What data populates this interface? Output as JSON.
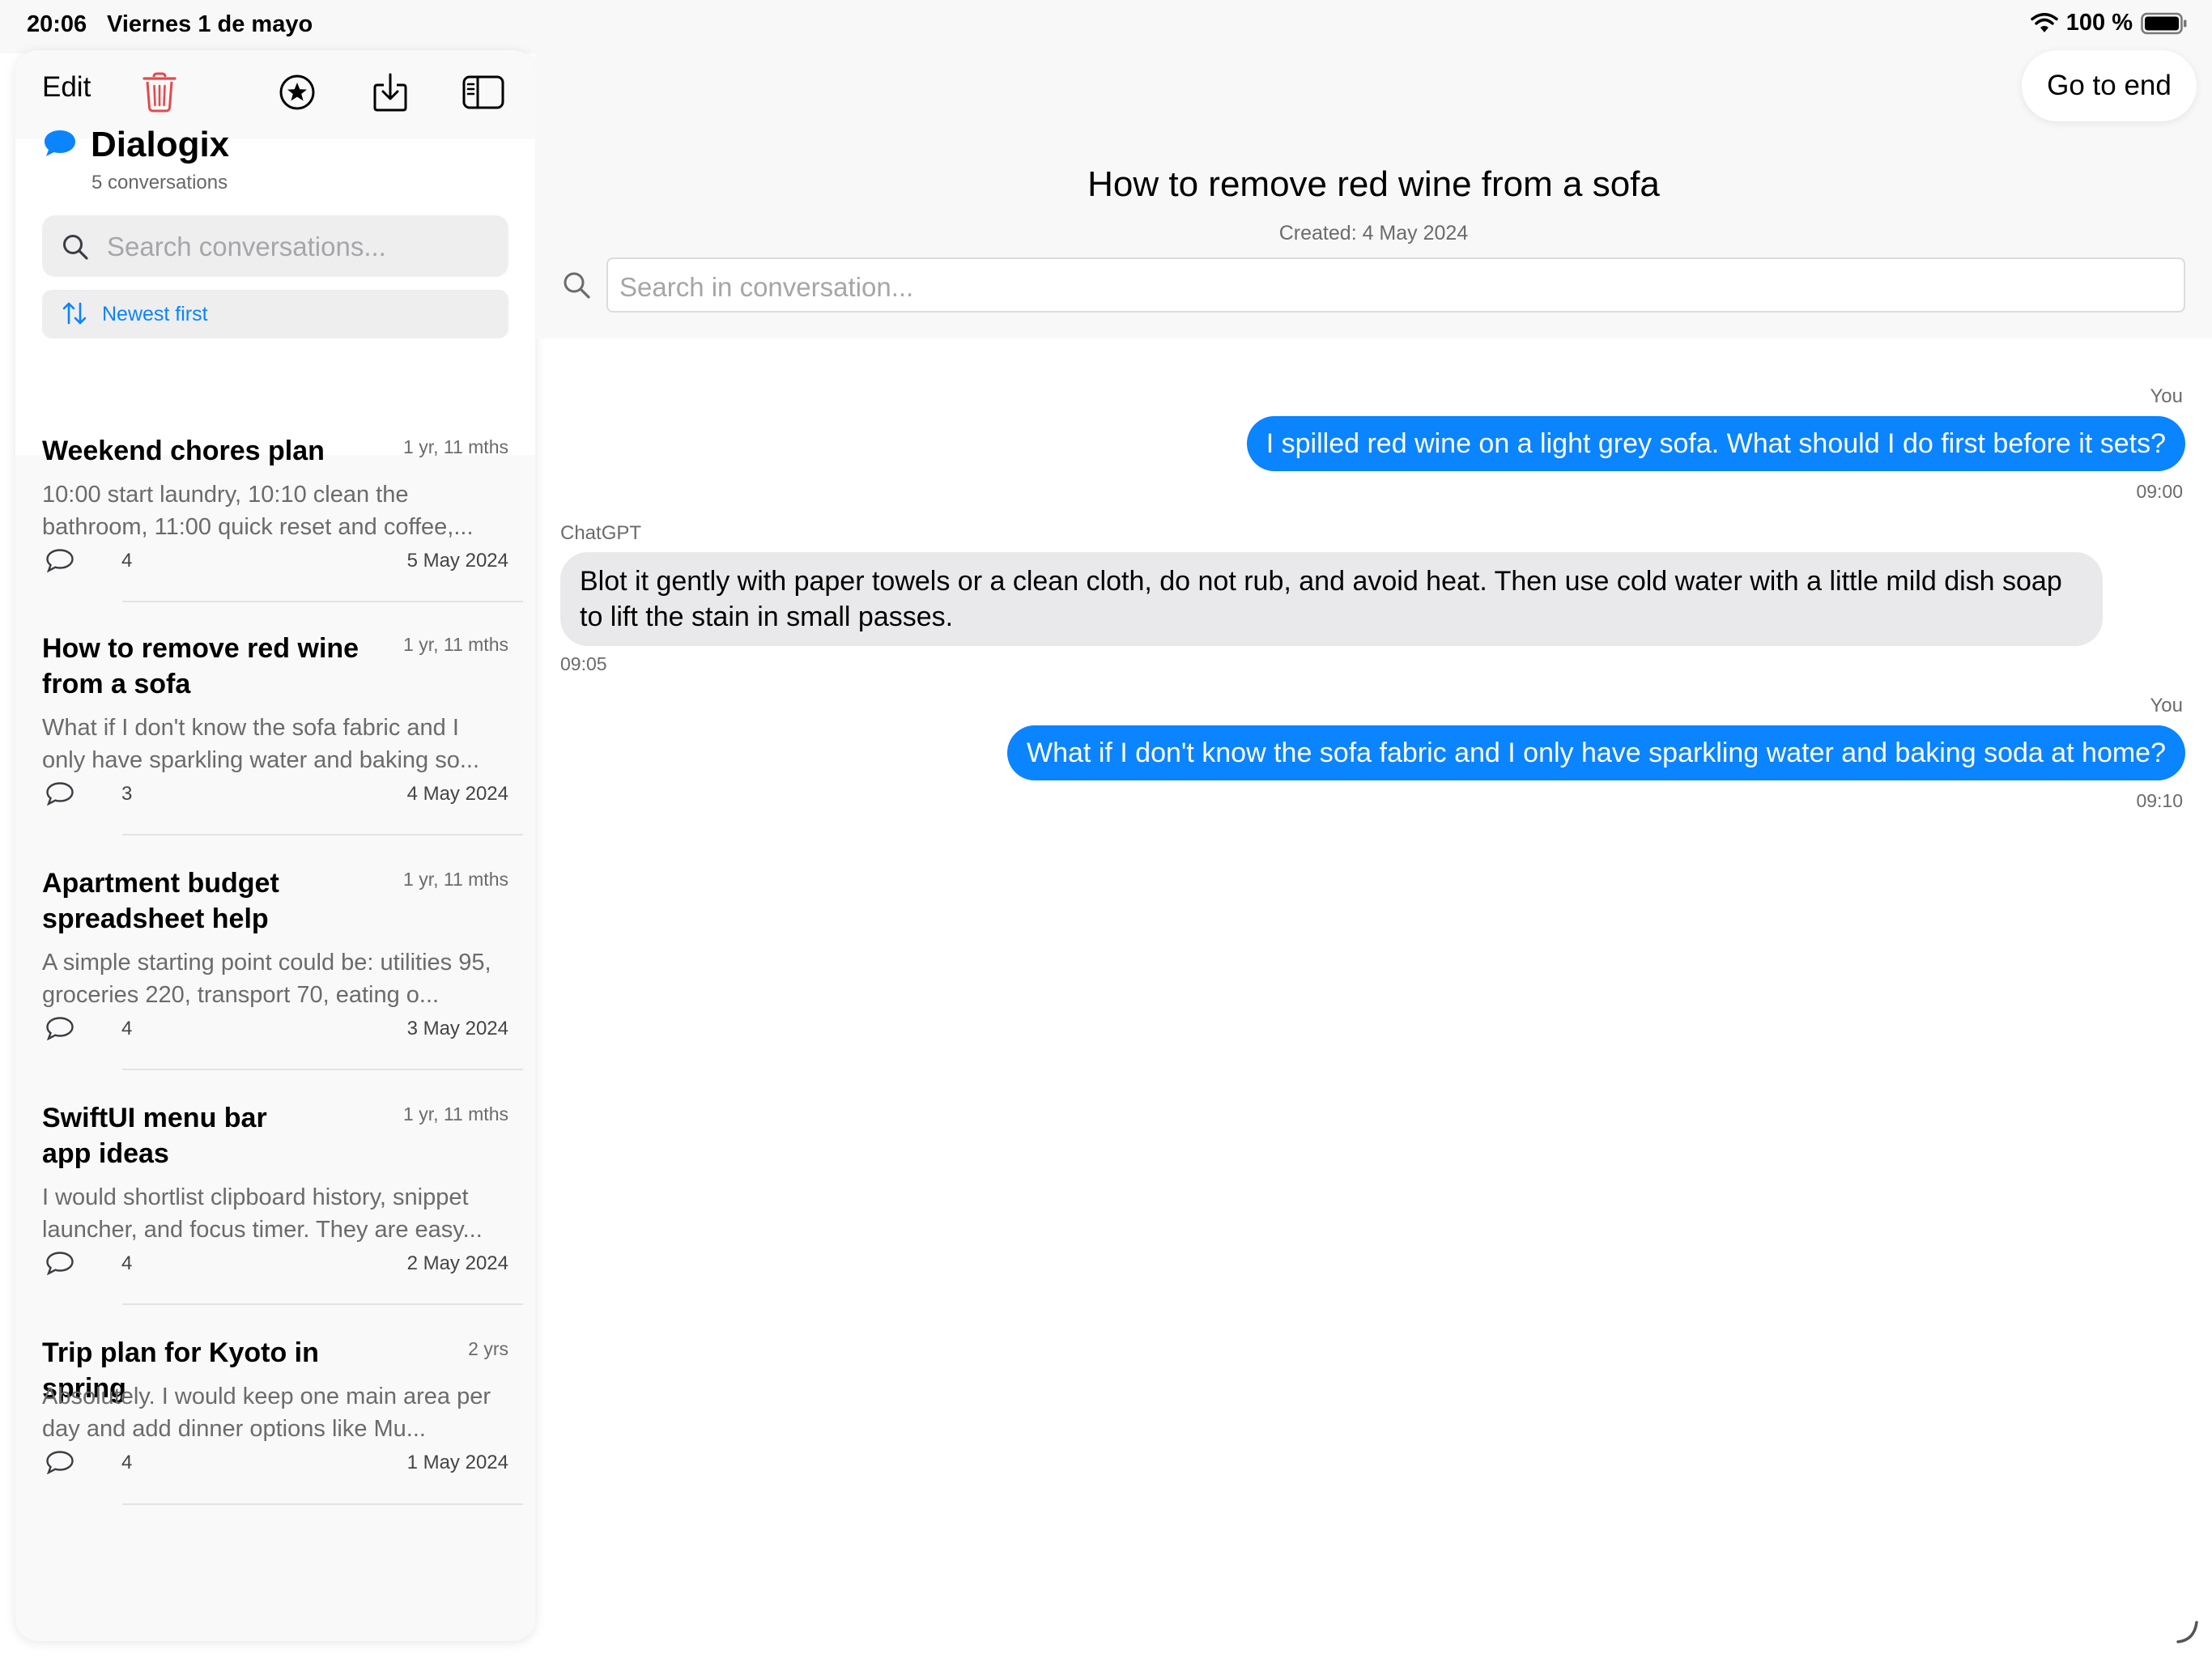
{
  "status_bar": {
    "time": "20:06",
    "date": "Viernes 1 de mayo",
    "battery": "100 %"
  },
  "sidebar": {
    "edit_label": "Edit",
    "app_title": "Dialogix",
    "conversation_count": "5 conversations",
    "search_placeholder": "Search conversations...",
    "sort_label": "Newest first",
    "conversations": [
      {
        "title": "Weekend chores plan",
        "age": "1 yr, 11 mths",
        "preview": "10:00 start laundry, 10:10 clean the bathroom, 11:00 quick reset and coffee,...",
        "messages": "4",
        "date": "5 May 2024"
      },
      {
        "title": "How to remove red wine from a sofa",
        "age": "1 yr, 11 mths",
        "preview": "What if I don't know the sofa fabric and I only have sparkling water and baking so...",
        "messages": "3",
        "date": "4 May 2024"
      },
      {
        "title": "Apartment budget spreadsheet help",
        "age": "1 yr, 11 mths",
        "preview": "A simple starting point could be: utilities 95, groceries 220, transport 70, eating o...",
        "messages": "4",
        "date": "3 May 2024"
      },
      {
        "title": "SwiftUI menu bar app ideas",
        "age": "1 yr, 11 mths",
        "preview": "I would shortlist clipboard history, snippet launcher, and focus timer. They are easy...",
        "messages": "4",
        "date": "2 May 2024"
      },
      {
        "title": "Trip plan for Kyoto in spring",
        "age": "2 yrs",
        "preview": "Absolutely. I would keep one main area per day and add dinner options like Mu...",
        "messages": "4",
        "date": "1 May 2024"
      }
    ]
  },
  "main": {
    "go_to_end_label": "Go to end",
    "title": "How to remove red wine from a sofa",
    "created": "Created: 4 May 2024",
    "search_placeholder": "Search in conversation...",
    "messages": [
      {
        "sender": "You",
        "text": "I spilled red wine on a light grey sofa. What should I do first before it sets?",
        "time": "09:00"
      },
      {
        "sender": "ChatGPT",
        "text": "Blot it gently with paper towels or a clean cloth, do not rub, and avoid heat. Then use cold water with a little mild dish soap to lift the stain in small passes.",
        "time": "09:05"
      },
      {
        "sender": "You",
        "text": "What if I don't know the sofa fabric and I only have sparkling water and baking soda at home?",
        "time": "09:10"
      }
    ]
  },
  "colors": {
    "accent": "#0a84ff",
    "delete_red": "#e5484d",
    "bot_bubble": "#e9e9eb"
  },
  "icons": [
    "wifi-icon",
    "battery-icon",
    "trash-icon",
    "star-circle-icon",
    "download-icon",
    "sidebar-toggle-icon",
    "chat-bubble-icon",
    "search-icon",
    "sort-arrows-icon",
    "comment-icon"
  ]
}
